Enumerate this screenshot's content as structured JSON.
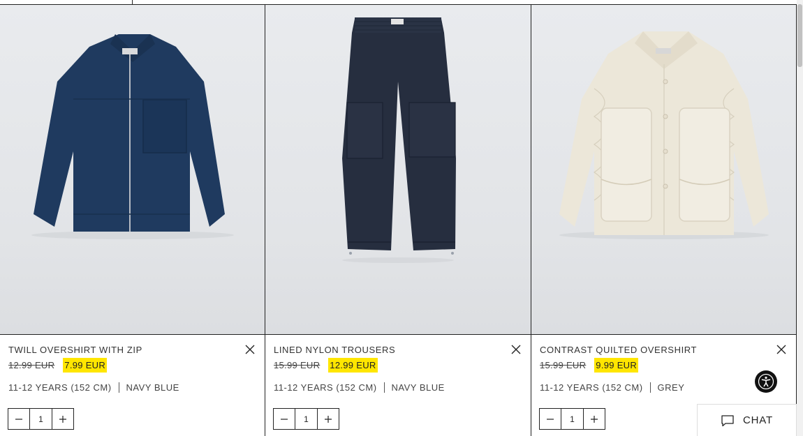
{
  "products": [
    {
      "name": "TWILL OVERSHIRT WITH ZIP",
      "old_price": "12.99 EUR",
      "new_price": "7.99 EUR",
      "size": "11-12 YEARS (152 CM)",
      "color": "NAVY BLUE",
      "quantity": "1",
      "image": "navy-zip-overshirt"
    },
    {
      "name": "LINED NYLON TROUSERS",
      "old_price": "15.99 EUR",
      "new_price": "12.99 EUR",
      "size": "11-12 YEARS (152 CM)",
      "color": "NAVY BLUE",
      "quantity": "1",
      "image": "navy-nylon-trousers"
    },
    {
      "name": "CONTRAST QUILTED OVERSHIRT",
      "old_price": "15.99 EUR",
      "new_price": "9.99 EUR",
      "size": "11-12 YEARS (152 CM)",
      "color": "GREY",
      "quantity": "1",
      "image": "cream-quilted-overshirt"
    }
  ],
  "chat": {
    "label": "CHAT",
    "icon": "chat-bubble-icon"
  },
  "accessibility": {
    "icon": "accessibility-icon"
  },
  "colors": {
    "sale_highlight": "#ffe600",
    "border": "#222222",
    "image_bg": "#e6e8eb"
  }
}
